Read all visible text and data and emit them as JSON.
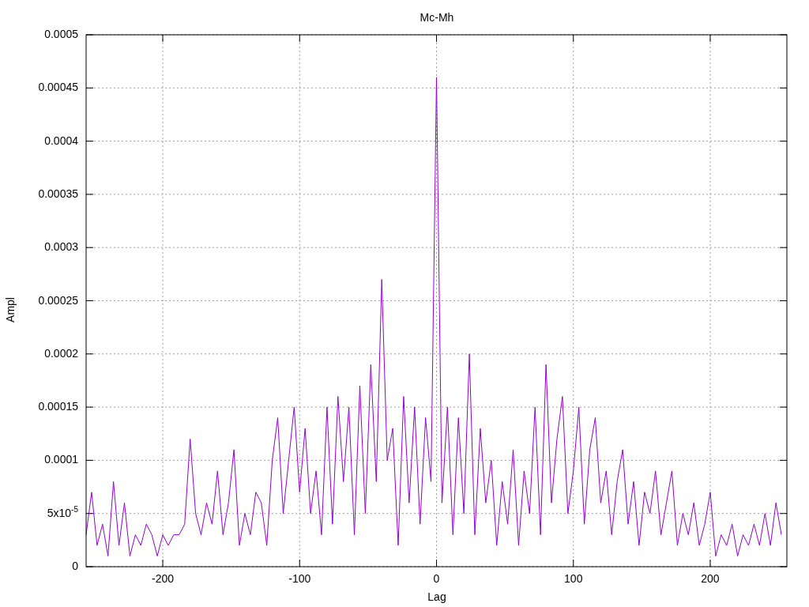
{
  "chart_data": {
    "type": "line",
    "title": "Mc-Mh",
    "xlabel": "Lag",
    "ylabel": "Ampl",
    "xlim": [
      -256,
      256
    ],
    "ylim": [
      0,
      0.0005
    ],
    "xticks": [
      -200,
      -100,
      0,
      100,
      200
    ],
    "yticks": [
      0,
      {
        "value": 5e-05,
        "label": "5x10$^{-5}$"
      },
      0.0001,
      0.00015,
      0.0002,
      0.00025,
      0.0003,
      0.00035,
      0.0004,
      0.00045,
      0.0005
    ],
    "x": [
      -256,
      -252,
      -248,
      -244,
      -240,
      -236,
      -232,
      -228,
      -224,
      -220,
      -216,
      -212,
      -208,
      -204,
      -200,
      -196,
      -192,
      -188,
      -184,
      -180,
      -176,
      -172,
      -168,
      -164,
      -160,
      -156,
      -152,
      -148,
      -144,
      -140,
      -136,
      -132,
      -128,
      -124,
      -120,
      -116,
      -112,
      -108,
      -104,
      -100,
      -96,
      -92,
      -88,
      -84,
      -80,
      -76,
      -72,
      -68,
      -64,
      -60,
      -56,
      -52,
      -48,
      -44,
      -40,
      -36,
      -32,
      -28,
      -24,
      -20,
      -16,
      -12,
      -8,
      -4,
      0,
      4,
      8,
      12,
      16,
      20,
      24,
      28,
      32,
      36,
      40,
      44,
      48,
      52,
      56,
      60,
      64,
      68,
      72,
      76,
      80,
      84,
      88,
      92,
      96,
      100,
      104,
      108,
      112,
      116,
      120,
      124,
      128,
      132,
      136,
      140,
      144,
      148,
      152,
      156,
      160,
      164,
      168,
      172,
      176,
      180,
      184,
      188,
      192,
      196,
      200,
      204,
      208,
      212,
      216,
      220,
      224,
      228,
      232,
      236,
      240,
      244,
      248,
      252
    ],
    "grid": true,
    "series": [
      {
        "color": "#9400d3",
        "values": [
          3e-05,
          7e-05,
          2e-05,
          4e-05,
          1e-05,
          8e-05,
          2e-05,
          6e-05,
          1e-05,
          3e-05,
          2e-05,
          4e-05,
          3e-05,
          1e-05,
          3e-05,
          2e-05,
          3e-05,
          3e-05,
          4e-05,
          0.00012,
          5e-05,
          3e-05,
          6e-05,
          4e-05,
          9e-05,
          3e-05,
          6e-05,
          0.00011,
          2e-05,
          5e-05,
          3e-05,
          7e-05,
          6e-05,
          2e-05,
          0.0001,
          0.00014,
          5e-05,
          0.0001,
          0.00015,
          7e-05,
          0.00013,
          5e-05,
          9e-05,
          3e-05,
          0.00015,
          4e-05,
          0.00016,
          8e-05,
          0.00015,
          3e-05,
          0.00017,
          5e-05,
          0.00019,
          8e-05,
          0.00027,
          0.0001,
          0.00013,
          2e-05,
          0.00016,
          6e-05,
          0.00015,
          4e-05,
          0.00014,
          8e-05,
          0.00046,
          6e-05,
          0.00015,
          3e-05,
          0.00014,
          5e-05,
          0.0002,
          3e-05,
          0.00013,
          6e-05,
          0.0001,
          2e-05,
          8e-05,
          4e-05,
          0.00011,
          2e-05,
          9e-05,
          5e-05,
          0.00015,
          3e-05,
          0.00019,
          6e-05,
          0.00012,
          0.00016,
          5e-05,
          9e-05,
          0.00015,
          4e-05,
          0.00011,
          0.00014,
          6e-05,
          9e-05,
          3e-05,
          8e-05,
          0.00011,
          4e-05,
          8e-05,
          2e-05,
          7e-05,
          5e-05,
          9e-05,
          3e-05,
          6e-05,
          9e-05,
          2e-05,
          5e-05,
          3e-05,
          6e-05,
          2e-05,
          4e-05,
          7e-05,
          1e-05,
          3e-05,
          2e-05,
          4e-05,
          1e-05,
          3e-05,
          2e-05,
          4e-05,
          2e-05,
          5e-05,
          2e-05,
          6e-05,
          3e-05
        ]
      }
    ]
  }
}
